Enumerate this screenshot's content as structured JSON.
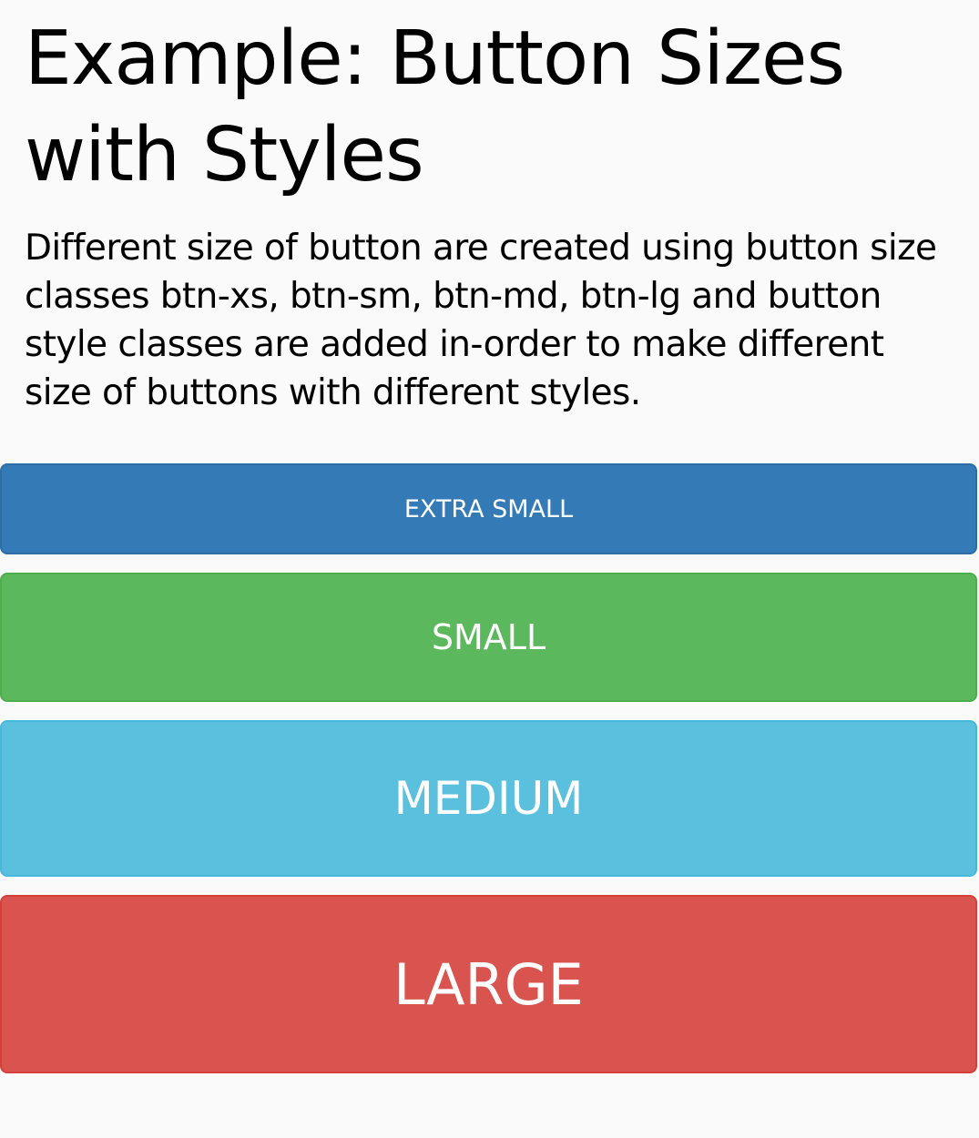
{
  "page": {
    "title_line1": "Example: Button Sizes",
    "title_line2": "with Styles",
    "description_lines": [
      "Different size of button are created using button size",
      "classes btn-xs, btn-sm, btn-md, btn-lg and button",
      "style classes are added in-order to make different",
      "size of buttons with different styles."
    ]
  },
  "buttons": {
    "extra_small": {
      "label": "EXTRA SMALL",
      "color": "#337ab7"
    },
    "small": {
      "label": "SMALL",
      "color": "#5cb85c"
    },
    "medium": {
      "label": "MEDIUM",
      "color": "#5bc0de"
    },
    "large": {
      "label": "LARGE",
      "color": "#d9534f"
    }
  }
}
